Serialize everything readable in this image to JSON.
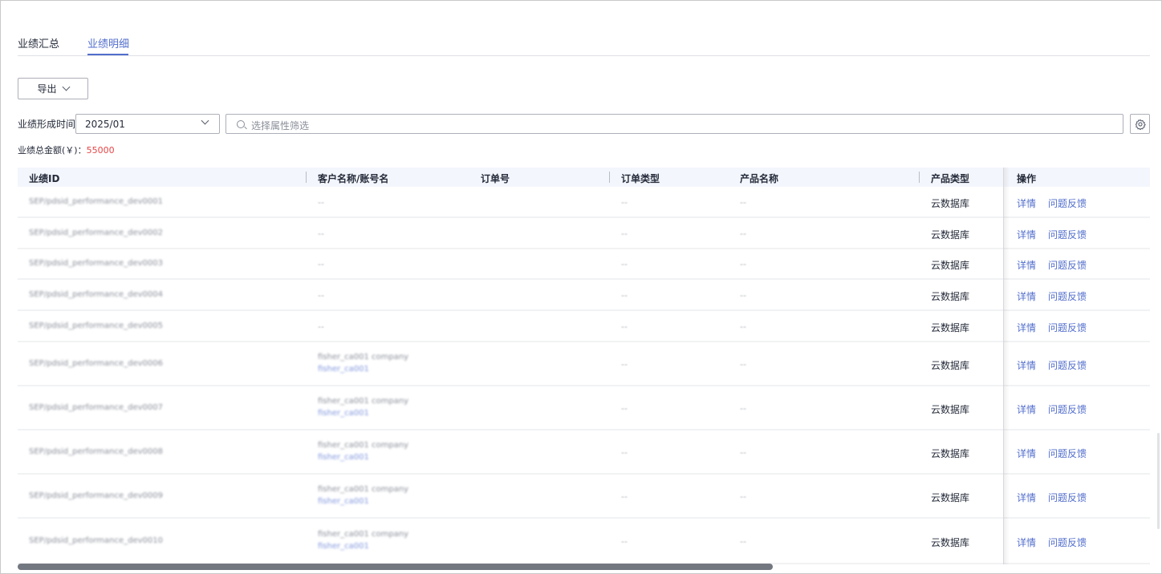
{
  "tabs": [
    {
      "label": "业绩汇总",
      "active": false
    },
    {
      "label": "业绩明细",
      "active": true
    }
  ],
  "toolbar": {
    "export_label": "导出"
  },
  "filter": {
    "time_label": "业绩形成时间",
    "month_value": "2025/01",
    "search_placeholder": "选择属性筛选"
  },
  "total": {
    "label": "业绩总金额(￥)：",
    "amount": "55000"
  },
  "colors": {
    "accent": "#526ecc",
    "amount": "#e54545",
    "header_bg": "#f3f6fc"
  },
  "icons": {
    "search": "search-icon",
    "settings": "gear-icon",
    "dropdown": "chevron-down-icon"
  },
  "table": {
    "columns": [
      "业绩ID",
      "客户名称/账号名",
      "订单号",
      "订单类型",
      "产品名称",
      "产品类型",
      "操作"
    ],
    "rows": [
      {
        "id": "SEP/pdsid_performance_dev0001",
        "customer": "--",
        "account": "",
        "order_type": "--",
        "product": "--",
        "product_type": "云数据库",
        "actions": [
          "详情",
          "问题反馈"
        ]
      },
      {
        "id": "SEP/pdsid_performance_dev0002",
        "customer": "--",
        "account": "",
        "order_type": "--",
        "product": "--",
        "product_type": "云数据库",
        "actions": [
          "详情",
          "问题反馈"
        ]
      },
      {
        "id": "SEP/pdsid_performance_dev0003",
        "customer": "--",
        "account": "",
        "order_type": "--",
        "product": "--",
        "product_type": "云数据库",
        "actions": [
          "详情",
          "问题反馈"
        ]
      },
      {
        "id": "SEP/pdsid_performance_dev0004",
        "customer": "--",
        "account": "",
        "order_type": "--",
        "product": "--",
        "product_type": "云数据库",
        "actions": [
          "详情",
          "问题反馈"
        ]
      },
      {
        "id": "SEP/pdsid_performance_dev0005",
        "customer": "--",
        "account": "",
        "order_type": "--",
        "product": "--",
        "product_type": "云数据库",
        "actions": [
          "详情",
          "问题反馈"
        ]
      },
      {
        "id": "SEP/pdsid_performance_dev0006",
        "customer": "fisher_ca001 company",
        "account": "fisher_ca001",
        "order_type": "--",
        "product": "--",
        "product_type": "云数据库",
        "actions": [
          "详情",
          "问题反馈"
        ]
      },
      {
        "id": "SEP/pdsid_performance_dev0007",
        "customer": "fisher_ca001 company",
        "account": "fisher_ca001",
        "order_type": "--",
        "product": "--",
        "product_type": "云数据库",
        "actions": [
          "详情",
          "问题反馈"
        ]
      },
      {
        "id": "SEP/pdsid_performance_dev0008",
        "customer": "fisher_ca001 company",
        "account": "fisher_ca001",
        "order_type": "--",
        "product": "--",
        "product_type": "云数据库",
        "actions": [
          "详情",
          "问题反馈"
        ]
      },
      {
        "id": "SEP/pdsid_performance_dev0009",
        "customer": "fisher_ca001 company",
        "account": "fisher_ca001",
        "order_type": "--",
        "product": "--",
        "product_type": "云数据库",
        "actions": [
          "详情",
          "问题反馈"
        ]
      },
      {
        "id": "SEP/pdsid_performance_dev0010",
        "customer": "fisher_ca001 company",
        "account": "fisher_ca001",
        "order_type": "--",
        "product": "--",
        "product_type": "云数据库",
        "actions": [
          "详情",
          "问题反馈"
        ]
      }
    ]
  }
}
